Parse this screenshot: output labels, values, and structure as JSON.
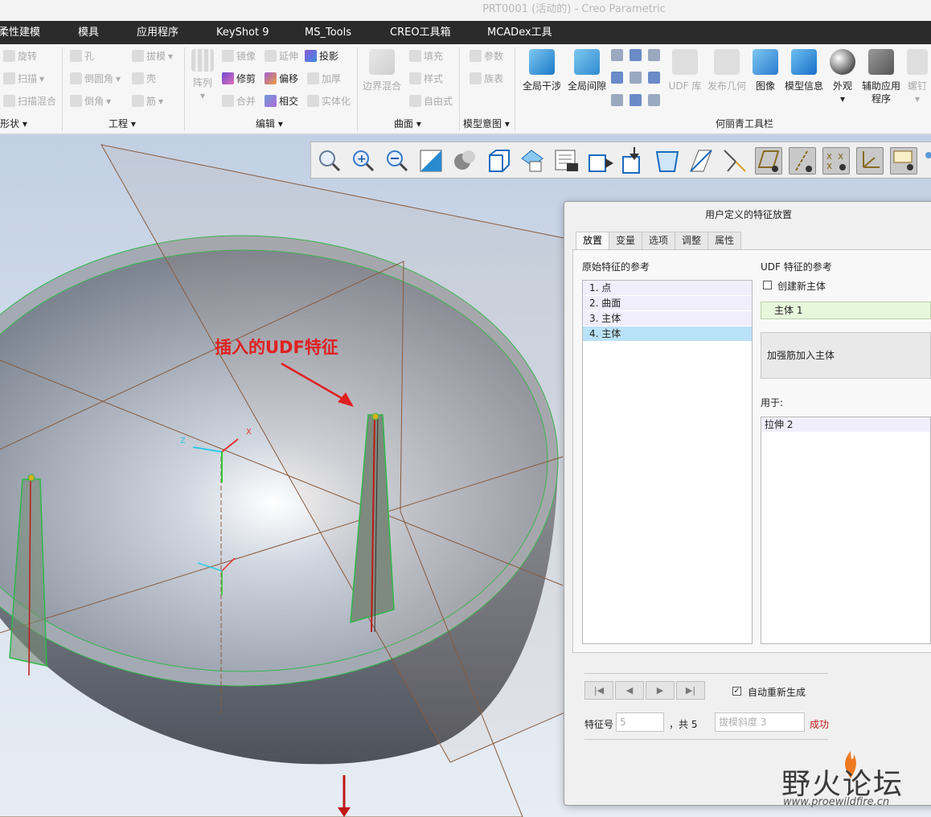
{
  "window": {
    "title": "PRT0001 (活动的) - Creo Parametric"
  },
  "ribbon_tabs": [
    "柔性建模",
    "模具",
    "应用程序",
    "KeyShot 9",
    "MS_Tools",
    "CREO工具箱",
    "MCADex工具"
  ],
  "ribbon": {
    "shape_group": {
      "buttons": [
        "旋转",
        "扫描",
        "扫描混合"
      ],
      "label": "形状"
    },
    "engineering_group": {
      "buttons": [
        "孔",
        "倒圆角",
        "倒角",
        "拔模",
        "壳",
        "筋"
      ],
      "label": "工程"
    },
    "edit_group": {
      "pattern": "阵列",
      "buttons": [
        "镜像",
        "延伸",
        "投影",
        "修剪",
        "偏移",
        "加厚",
        "合并",
        "相交",
        "实体化"
      ],
      "label": "编辑"
    },
    "surface_group": {
      "blend": "边界混合",
      "buttons": [
        "填充",
        "样式",
        "自由式"
      ],
      "label": "曲面"
    },
    "model_intent_group": {
      "buttons": [
        "参数",
        "族表"
      ],
      "label": "模型意图"
    },
    "custom_toolbar": {
      "buttons": [
        "全局干涉",
        "全局间隙",
        "UDF 库",
        "发布几何",
        "图像",
        "模型信息",
        "外观",
        "辅助应用程序",
        "螺钉"
      ],
      "label": "何丽青工具栏"
    }
  },
  "annotation": {
    "text": "插入的UDF特征"
  },
  "dialog": {
    "title": "用户定义的特征放置",
    "tabs": [
      "放置",
      "变量",
      "选项",
      "调整",
      "属性"
    ],
    "selected_tab": "放置",
    "original_refs_label": "原始特征的参考",
    "original_refs": [
      "1. 点",
      "2. 曲面",
      "3. 主体",
      "4. 主体"
    ],
    "selected_ref_index": 3,
    "udf_refs_label": "UDF 特征的参考",
    "create_new_body_label": "创建新主体",
    "create_new_body_checked": false,
    "body_value": "主体 1",
    "add_to_body_button": "加强筋加入主体",
    "applied_to_label": "用于:",
    "applied_to": [
      "拉伸 2"
    ],
    "auto_regen_label": "自动重新生成",
    "auto_regen_checked": true,
    "feature_no_label": "特征号",
    "feature_no_value": "5",
    "total_text": "，共 5",
    "feature_name_value": "拔模斜度 3",
    "status": "成功"
  },
  "watermark": {
    "text": "野火论坛",
    "url": "www.proewildfire.cn"
  },
  "colors": {
    "annotation": "#e02020",
    "tab_bar": "#2b2b2b",
    "selected_list": "#b9e2f9",
    "body_highlight": "#e7f7dc",
    "status": "#c01818"
  }
}
